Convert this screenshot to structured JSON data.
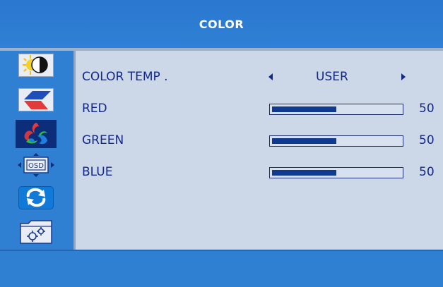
{
  "header": {
    "title": "COLOR"
  },
  "sidebar": {
    "tabs": [
      {
        "name": "brightness-contrast"
      },
      {
        "name": "image"
      },
      {
        "name": "color",
        "selected": true
      },
      {
        "name": "osd-setting",
        "icon_text": "OSD"
      },
      {
        "name": "reset"
      },
      {
        "name": "misc-settings"
      }
    ]
  },
  "color_temp": {
    "label": "COLOR TEMP .",
    "value": "USER"
  },
  "rgb": [
    {
      "label": "RED",
      "value": "50",
      "level_percent": 50
    },
    {
      "label": "GREEN",
      "value": "50",
      "level_percent": 50
    },
    {
      "label": "BLUE",
      "value": "50",
      "level_percent": 50
    }
  ],
  "colors": {
    "osd_blue": "#2f7fd3",
    "panel": "#ccd7e8",
    "text": "#13288a",
    "selected_tab": "#0b2d7a",
    "slider_fill": "#0f3a8f"
  }
}
